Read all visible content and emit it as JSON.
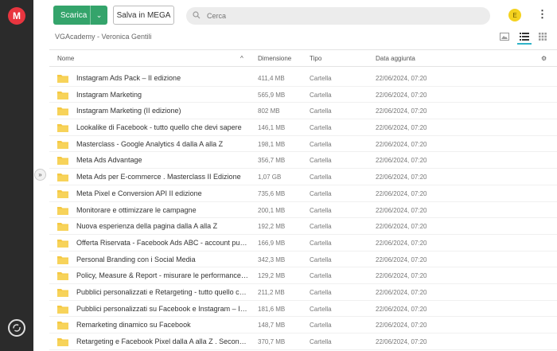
{
  "app": {
    "logo_letter": "M"
  },
  "toolbar": {
    "download_label": "Scarica",
    "download_chevron": "⌄",
    "save_label": "Salva in MEGA"
  },
  "search": {
    "placeholder": "Cerca",
    "icon": "search-icon"
  },
  "account": {
    "avatar_initial": "E",
    "avatar_color": "#f4d21f"
  },
  "breadcrumb": "VGAcademy - Veronica Gentili",
  "columns": {
    "name": "Nome",
    "size": "Dimensione",
    "type": "Tipo",
    "date": "Data aggiunta"
  },
  "colors": {
    "accent": "#34a46b",
    "brand": "#e8353f",
    "folder": "#f5c842",
    "active_view": "#2fb3c8"
  },
  "rows": [
    {
      "name": "Instagram Ads Pack – II edizione",
      "size": "411,4 MB",
      "type": "Cartella",
      "date": "22/06/2024, 07:20"
    },
    {
      "name": "Instagram Marketing",
      "size": "565,9 MB",
      "type": "Cartella",
      "date": "22/06/2024, 07:20"
    },
    {
      "name": "Instagram Marketing (II edizione)",
      "size": "802 MB",
      "type": "Cartella",
      "date": "22/06/2024, 07:20"
    },
    {
      "name": "Lookalike di Facebook - tutto quello che devi sapere",
      "size": "146,1 MB",
      "type": "Cartella",
      "date": "22/06/2024, 07:20"
    },
    {
      "name": "Masterclass - Google Analytics 4 dalla A alla Z",
      "size": "198,1 MB",
      "type": "Cartella",
      "date": "22/06/2024, 07:20"
    },
    {
      "name": "Meta Ads Advantage",
      "size": "356,7 MB",
      "type": "Cartella",
      "date": "22/06/2024, 07:20"
    },
    {
      "name": "Meta Ads per E-commerce . Masterclass II Edizione",
      "size": "1,07 GB",
      "type": "Cartella",
      "date": "22/06/2024, 07:20"
    },
    {
      "name": "Meta Pixel e Conversion API II edizione",
      "size": "735,6 MB",
      "type": "Cartella",
      "date": "22/06/2024, 07:20"
    },
    {
      "name": "Monitorare e ottimizzare le campagne",
      "size": "200,1 MB",
      "type": "Cartella",
      "date": "22/06/2024, 07:20"
    },
    {
      "name": "Nuova esperienza della pagina dalla A alla Z",
      "size": "192,2 MB",
      "type": "Cartella",
      "date": "22/06/2024, 07:20"
    },
    {
      "name": "Offerta Riservata - Facebook Ads ABC - account pub...",
      "size": "166,9 MB",
      "type": "Cartella",
      "date": "22/06/2024, 07:20"
    },
    {
      "name": "Personal Branding con i Social Media",
      "size": "342,3 MB",
      "type": "Cartella",
      "date": "22/06/2024, 07:20"
    },
    {
      "name": "Policy, Measure & Report - misurare le performance ...",
      "size": "129,2 MB",
      "type": "Cartella",
      "date": "22/06/2024, 07:20"
    },
    {
      "name": "Pubblici personalizzati e Retargeting - tutto quello ch...",
      "size": "211,2 MB",
      "type": "Cartella",
      "date": "22/06/2024, 07:20"
    },
    {
      "name": "Pubblici personalizzati su Facebook e Instagram – II e...",
      "size": "181,6 MB",
      "type": "Cartella",
      "date": "22/06/2024, 07:20"
    },
    {
      "name": "Remarketing dinamico su Facebook",
      "size": "148,7 MB",
      "type": "Cartella",
      "date": "22/06/2024, 07:20"
    },
    {
      "name": "Retargeting e Facebook Pixel dalla A alla Z . Seconda ...",
      "size": "370,7 MB",
      "type": "Cartella",
      "date": "22/06/2024, 07:20"
    }
  ]
}
